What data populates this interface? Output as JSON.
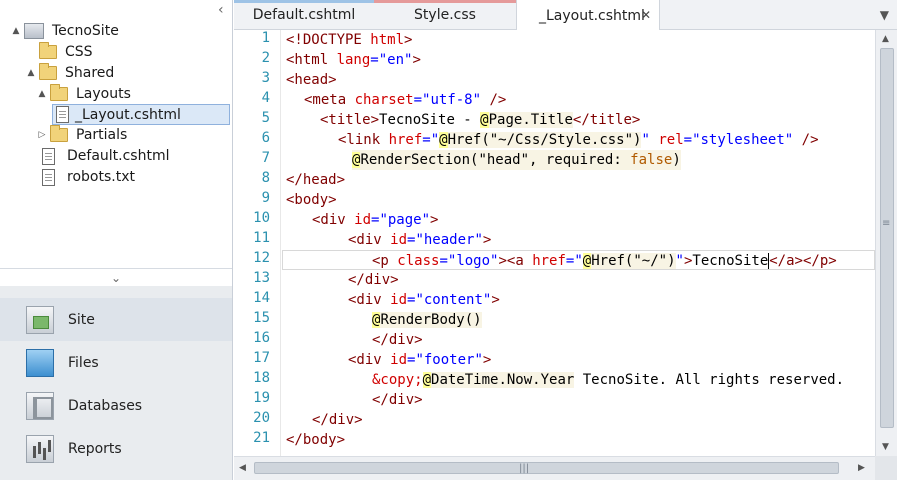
{
  "tree": [
    {
      "label": "TecnoSite",
      "type": "site",
      "expander": "▲"
    },
    {
      "label": "CSS",
      "type": "folder",
      "expander": ""
    },
    {
      "label": "Shared",
      "type": "folder",
      "expander": "▲"
    },
    {
      "label": "Layouts",
      "type": "folder",
      "expander": "▲"
    },
    {
      "label": "_Layout.cshtml",
      "type": "file",
      "expander": "",
      "selected": true
    },
    {
      "label": "Partials",
      "type": "folder",
      "expander": "▷"
    },
    {
      "label": "Default.cshtml",
      "type": "file",
      "expander": ""
    },
    {
      "label": "robots.txt",
      "type": "file",
      "expander": ""
    }
  ],
  "workspaces": [
    {
      "label": "Site",
      "icon": "site-icon"
    },
    {
      "label": "Files",
      "icon": "files-icon"
    },
    {
      "label": "Databases",
      "icon": "database-icon"
    },
    {
      "label": "Reports",
      "icon": "reports-icon"
    }
  ],
  "tabs": [
    {
      "label": "Default.cshtml",
      "stripe": "#9ec3e6"
    },
    {
      "label": "Style.css",
      "stripe": "#e59a9a"
    },
    {
      "label": "_Layout.cshtml",
      "stripe": "",
      "active": true
    }
  ],
  "close_glyph": "✕",
  "line_numbers": [
    "1",
    "2",
    "3",
    "4",
    "5",
    "6",
    "7",
    "8",
    "9",
    "10",
    "11",
    "12",
    "13",
    "14",
    "15",
    "16",
    "17",
    "18",
    "19",
    "20",
    "21"
  ],
  "code": {
    "l1": [
      "<!DOCTYPE ",
      "html",
      ">"
    ],
    "l2": [
      "<html ",
      "lang",
      "=",
      "\"en\"",
      ">"
    ],
    "l3": "<head>",
    "l4": [
      "<meta ",
      "charset",
      "=",
      "\"utf-8\"",
      " />"
    ],
    "l5": [
      "<title>",
      "TecnoSite - ",
      "@",
      "Page.Title",
      "</title>"
    ],
    "l6": [
      "<link ",
      "href",
      "=",
      "\"",
      "@",
      "Href(\"~/Css/Style.css\")",
      "\"",
      " rel",
      "=",
      "\"stylesheet\"",
      " />"
    ],
    "l7": [
      "@",
      "RenderSection(\"head\", ",
      "required",
      ": ",
      "false",
      ")"
    ],
    "l8": "</head>",
    "l9": "<body>",
    "l10": [
      "<div ",
      "id",
      "=",
      "\"page\"",
      ">"
    ],
    "l11": [
      "<div ",
      "id",
      "=",
      "\"header\"",
      ">"
    ],
    "l12": [
      "<p ",
      "class",
      "=",
      "\"logo\"",
      "><a ",
      "href",
      "=",
      "\"",
      "@",
      "Href(\"~/\")",
      "\"",
      ">",
      "TecnoSite",
      "</a></p>"
    ],
    "l13": "</div>",
    "l14": [
      "<div ",
      "id",
      "=",
      "\"content\"",
      ">"
    ],
    "l15": [
      "@",
      "RenderBody()"
    ],
    "l16": "</div>",
    "l17": [
      "<div ",
      "id",
      "=",
      "\"footer\"",
      ">"
    ],
    "l18": [
      "&copy;",
      "@",
      "DateTime.Now.Year",
      " TecnoSite. All rights reserved."
    ],
    "l19": "</div>",
    "l20": "</div>",
    "l21": "</body>"
  }
}
